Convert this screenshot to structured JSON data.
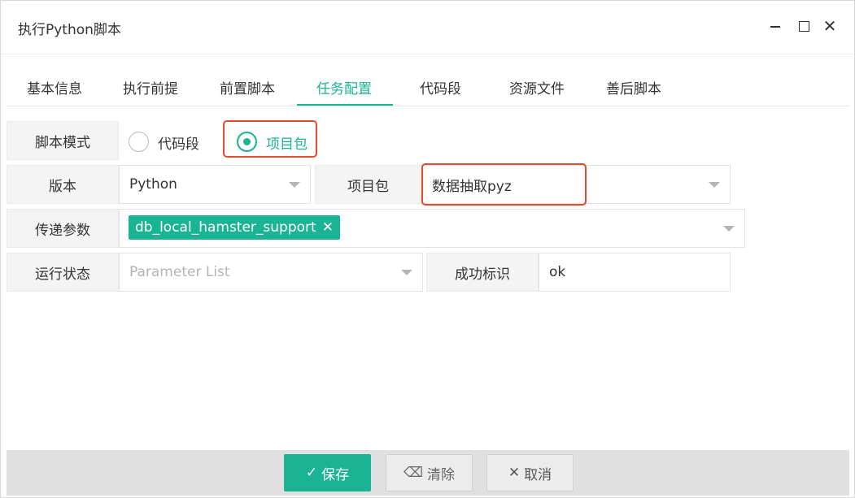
{
  "window": {
    "title": "执行Python脚本"
  },
  "tabs": [
    {
      "label": "基本信息"
    },
    {
      "label": "执行前提"
    },
    {
      "label": "前置脚本"
    },
    {
      "label": "任务配置",
      "active": true
    },
    {
      "label": "代码段"
    },
    {
      "label": "资源文件"
    },
    {
      "label": "善后脚本"
    }
  ],
  "form": {
    "script_mode": {
      "label": "脚本模式",
      "options": [
        {
          "label": "代码段",
          "selected": false
        },
        {
          "label": "项目包",
          "selected": true
        }
      ]
    },
    "version": {
      "label": "版本",
      "value": "Python"
    },
    "project_package": {
      "label": "项目包",
      "value": "数据抽取pyz"
    },
    "params": {
      "label": "传递参数",
      "tags": [
        "db_local_hamster_support"
      ]
    },
    "run_state": {
      "label": "运行状态",
      "placeholder": "Parameter List"
    },
    "success_flag": {
      "label": "成功标识",
      "value": "ok"
    }
  },
  "footer": {
    "save_label": "保存",
    "clear_label": "清除",
    "cancel_label": "取消"
  },
  "colors": {
    "accent": "#1ab394",
    "highlight": "#e64a2e"
  },
  "icons": [
    "minimize-icon",
    "maximize-icon",
    "close-icon",
    "check-icon",
    "eraser-icon",
    "x-icon",
    "chevron-down-icon"
  ]
}
